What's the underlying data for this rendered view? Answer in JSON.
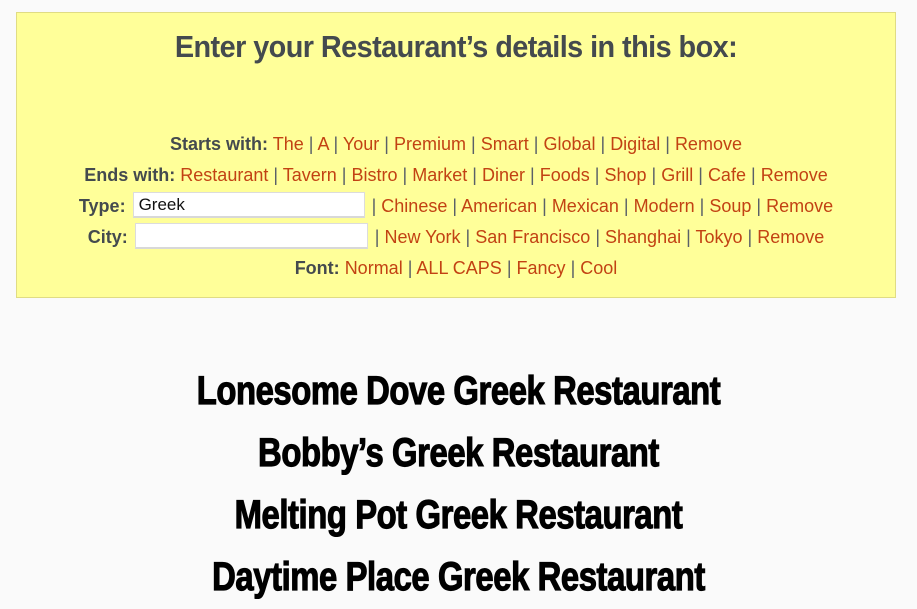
{
  "form": {
    "title": "Enter your Restaurant’s details in this box:",
    "starts_with": {
      "label": "Starts with:",
      "options": [
        "The",
        "A",
        "Your",
        "Premium",
        "Smart",
        "Global",
        "Digital",
        "Remove"
      ]
    },
    "ends_with": {
      "label": "Ends with:",
      "options": [
        "Restaurant",
        "Tavern",
        "Bistro",
        "Market",
        "Diner",
        "Foods",
        "Shop",
        "Grill",
        "Cafe",
        "Remove"
      ]
    },
    "type": {
      "label": "Type:",
      "value": "Greek",
      "placeholder": "",
      "options": [
        "Chinese",
        "American",
        "Mexican",
        "Modern",
        "Soup",
        "Remove"
      ]
    },
    "city": {
      "label": "City:",
      "value": "",
      "placeholder": "",
      "options": [
        "New York",
        "San Francisco",
        "Shanghai",
        "Tokyo",
        "Remove"
      ]
    },
    "font": {
      "label": "Font:",
      "options": [
        "Normal",
        "ALL CAPS",
        "Fancy",
        "Cool"
      ]
    }
  },
  "results": [
    "Lonesome Dove Greek Restaurant",
    "Bobby’s Greek Restaurant",
    "Melting Pot Greek Restaurant",
    "Daytime Place Greek Restaurant"
  ],
  "colors": {
    "box_background": "#ffff99",
    "link": "#c24213",
    "label": "#444a4e"
  }
}
